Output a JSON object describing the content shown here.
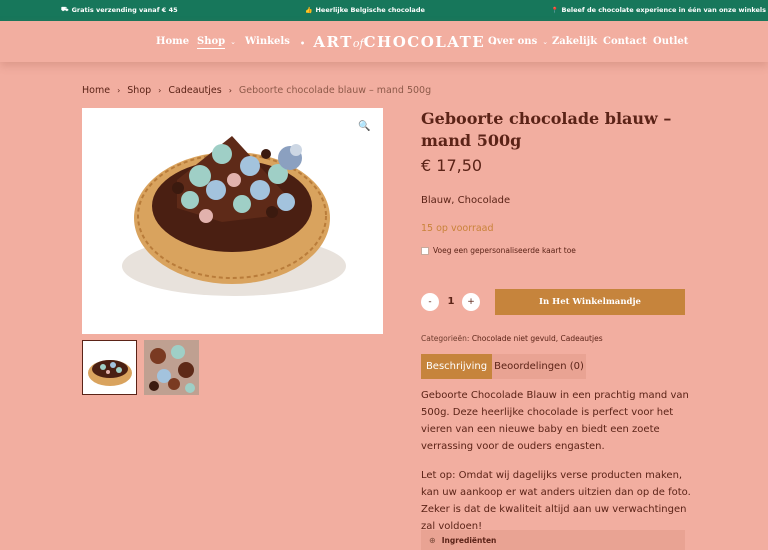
{
  "topbar": {
    "items": [
      {
        "icon": "truck-icon",
        "glyph": "⛟",
        "text": "Gratis verzending vanaf € 45"
      },
      {
        "icon": "thumbs-up-icon",
        "glyph": "👍",
        "text": "Heerlijke Belgische chocolade"
      },
      {
        "icon": "map-pin-icon",
        "glyph": "📍",
        "text": "Beleef de chocolate experience in één van onze winkels"
      }
    ],
    "background": "#17775b"
  },
  "nav": {
    "left": [
      {
        "label": "Home"
      },
      {
        "label": "Shop"
      },
      {
        "label": "Winkels"
      }
    ],
    "right": [
      {
        "label": "Over ons"
      },
      {
        "label": "Zakelijk"
      },
      {
        "label": "Contact"
      },
      {
        "label": "Outlet"
      }
    ],
    "logo": {
      "part1": "ART",
      "part2": "of",
      "part3": "CHOCOLATE"
    },
    "dropdown_icon": "chevron-down-icon"
  },
  "breadcrumb": [
    "Home",
    "Shop",
    "Cadeautjes",
    "Geboorte chocolade blauw – mand 500g"
  ],
  "product": {
    "title": "Geboorte chocolade blauw – mand 500g",
    "price": "€ 17,50",
    "tags": "Blauw, Chocolade",
    "stock": "15 op voorraad",
    "card_option": "Voeg een gepersonaliseerde kaart toe",
    "quantity": "1",
    "minus": "-",
    "plus": "+",
    "add_to_cart": "In Het Winkelmandje",
    "categories_label": "Categorieën:",
    "categories": "Chocolade niet gevuld, Cadeautjes"
  },
  "tabs": [
    {
      "label": "Beschrijving"
    },
    {
      "label": "Beoordelingen (0)"
    }
  ],
  "description": {
    "p1": "Geboorte Chocolade Blauw in een prachtig mand van 500g. Deze heerlijke chocolade is perfect voor het vieren van een nieuwe baby en biedt een zoete verrassing voor de ouders engasten.",
    "p2": "Let op: Omdat wij dagelijks verse producten maken, kan uw aankoop er wat anders uitzien dan op de foto. Zeker is dat de kwaliteit altijd aan uw verwachtingen zal voldoen!"
  },
  "accordion": {
    "label": "Ingrediënten",
    "icon": "plus-circle-icon"
  },
  "colors": {
    "page": "#f2aea0",
    "brown": "#5b2317",
    "accent": "#c6843c",
    "green": "#17775b"
  }
}
